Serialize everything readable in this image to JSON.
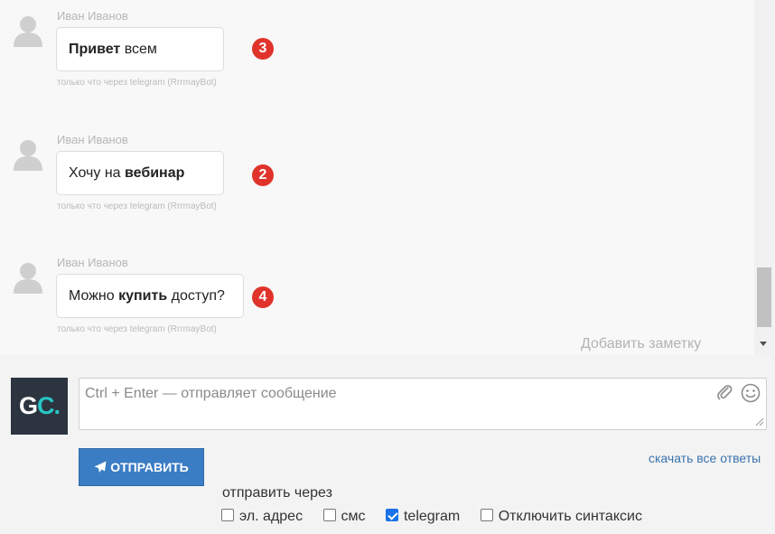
{
  "messages": [
    {
      "author": "Иван Иванов",
      "parts": [
        {
          "text": "Привет",
          "bold": true
        },
        {
          "text": " всем",
          "bold": false
        }
      ],
      "meta": "только что через telegram (RrrmayBot)",
      "badge": "3"
    },
    {
      "author": "Иван Иванов",
      "parts": [
        {
          "text": "Хочу на ",
          "bold": false
        },
        {
          "text": "вебинар",
          "bold": true
        }
      ],
      "meta": "только что через telegram (RrrmayBot)",
      "badge": "2"
    },
    {
      "author": "Иван Иванов",
      "parts": [
        {
          "text": "Можно ",
          "bold": false
        },
        {
          "text": "купить",
          "bold": true
        },
        {
          "text": " доступ?",
          "bold": false
        }
      ],
      "meta": "только что через telegram (RrrmayBot)",
      "badge": "4"
    }
  ],
  "chat": {
    "add_note": "Добавить заметку"
  },
  "compose": {
    "logo_g": "G",
    "logo_c": "C",
    "logo_dot": ".",
    "placeholder": "Ctrl + Enter — отправляет сообщение",
    "attach_icon": "paperclip-icon",
    "emoji_icon": "smile-icon",
    "send_label": "ОТПРАВИТЬ",
    "download_link": "скачать все ответы",
    "send_via_label": "отправить через",
    "channels": [
      {
        "label": "эл. адрес",
        "checked": false
      },
      {
        "label": "смс",
        "checked": false
      },
      {
        "label": "telegram",
        "checked": true
      },
      {
        "label": "Отключить синтаксис",
        "checked": false
      }
    ]
  },
  "colors": {
    "accent": "#3b7dc4",
    "badge": "#e0332b",
    "logo_bg": "#2c3440",
    "logo_accent": "#28c5c5"
  }
}
